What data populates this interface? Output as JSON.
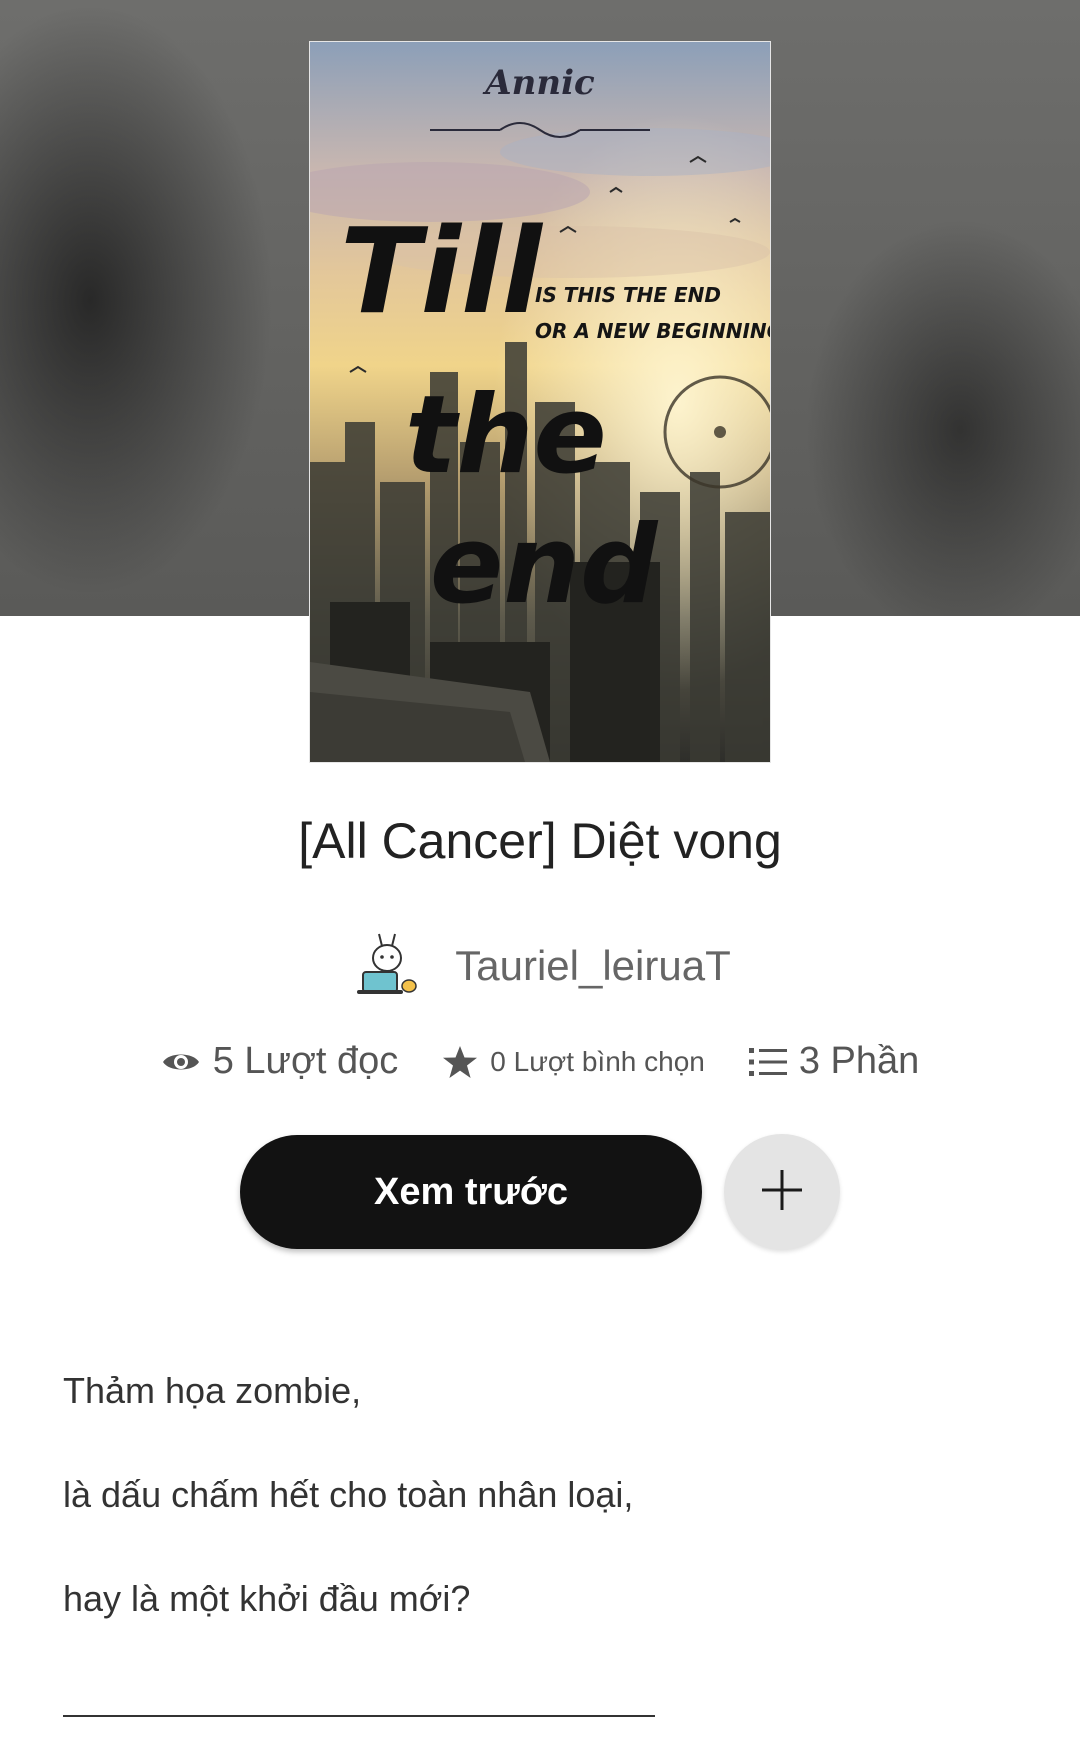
{
  "cover": {
    "author_text": "Annic",
    "title_lines": [
      "Till",
      "the",
      "end"
    ],
    "tagline_lines": [
      "IS THIS THE END",
      "OR A NEW BEGINNING?"
    ]
  },
  "story": {
    "title": "[All Cancer] Diệt vong",
    "author": "Tauriel_leiruaT"
  },
  "stats": {
    "reads": "5 Lượt đọc",
    "votes": "0 Lượt bình chọn",
    "parts": "3 Phần"
  },
  "actions": {
    "preview_label": "Xem trước",
    "add_icon": "plus-icon"
  },
  "description": {
    "lines": [
      "Thảm họa zombie,",
      "là dấu chấm hết cho toàn nhân loại,",
      "hay là một khởi đầu mới?"
    ]
  },
  "icons": {
    "reads": "eye-icon",
    "votes": "star-icon",
    "parts": "list-icon"
  },
  "colors": {
    "button_dark": "#121212",
    "button_light": "#e4e4e4",
    "text_muted": "#666666"
  }
}
